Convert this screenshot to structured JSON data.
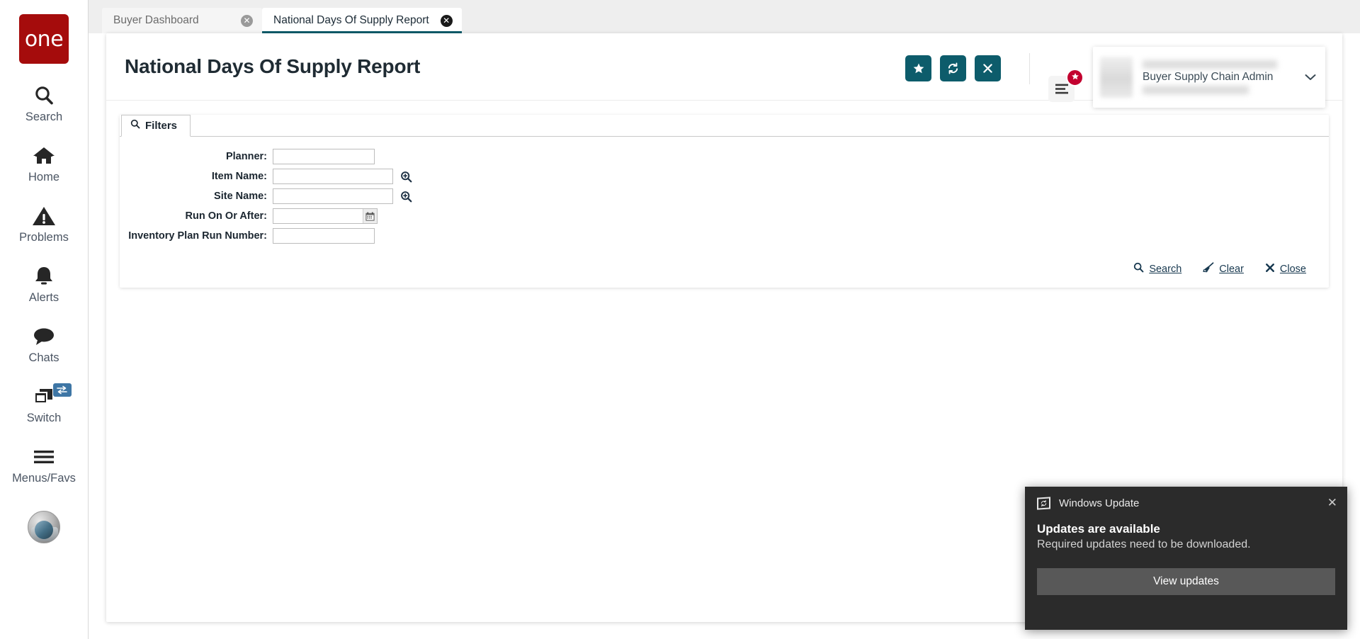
{
  "brand": {
    "logo_text": "one",
    "logo_color": "#a50c0c"
  },
  "theme": {
    "accent": "#0d5c6b",
    "badge": "#c3002f",
    "link": "#17384f"
  },
  "rail": {
    "items": [
      {
        "label": "Search",
        "icon": "search-icon"
      },
      {
        "label": "Home",
        "icon": "home-icon"
      },
      {
        "label": "Problems",
        "icon": "warning-triangle-icon"
      },
      {
        "label": "Alerts",
        "icon": "bell-icon"
      },
      {
        "label": "Chats",
        "icon": "chat-bubble-icon"
      },
      {
        "label": "Switch",
        "icon": "windows-stack-icon",
        "badge_icon": "swap-arrows-icon"
      },
      {
        "label": "Menus/Favs",
        "icon": "hamburger-icon"
      }
    ]
  },
  "tabs": [
    {
      "label": "Buyer Dashboard",
      "active": false,
      "close_icon": "close-circle-icon"
    },
    {
      "label": "National Days Of Supply Report",
      "active": true,
      "close_icon": "close-circle-icon"
    }
  ],
  "header": {
    "title": "National Days Of Supply Report",
    "actions": [
      {
        "name": "favorite-button",
        "icon": "star-icon"
      },
      {
        "name": "refresh-button",
        "icon": "refresh-icon"
      },
      {
        "name": "close-button",
        "icon": "x-icon"
      }
    ],
    "menu_icon": "hamburger-icon",
    "menu_badge_icon": "star-icon",
    "user": {
      "role": "Buyer Supply Chain Admin",
      "caret_icon": "chevron-down-icon"
    }
  },
  "filters": {
    "tab_label": "Filters",
    "tab_icon": "search-icon",
    "fields": [
      {
        "label": "Planner:",
        "value": "",
        "placeholder": "",
        "width": "short",
        "trailing_icon": null
      },
      {
        "label": "Item Name:",
        "value": "",
        "placeholder": "",
        "width": "long",
        "trailing_icon": "magnifier-plus-icon"
      },
      {
        "label": "Site Name:",
        "value": "",
        "placeholder": "",
        "width": "long",
        "trailing_icon": "magnifier-plus-icon"
      },
      {
        "label": "Run On Or After:",
        "value": "",
        "placeholder": "",
        "width": "date",
        "trailing_icon": "calendar-icon"
      },
      {
        "label": "Inventory Plan Run Number:",
        "value": "",
        "placeholder": "",
        "width": "short",
        "trailing_icon": null
      }
    ],
    "actions": [
      {
        "label": "Search",
        "icon": "search-icon"
      },
      {
        "label": "Clear",
        "icon": "broom-icon"
      },
      {
        "label": "Close",
        "icon": "x-icon"
      }
    ]
  },
  "toast": {
    "app_title": "Windows Update",
    "app_icon": "windows-update-icon",
    "close_icon": "close-icon",
    "title": "Updates are available",
    "subtitle": "Required updates need to be downloaded.",
    "button_label": "View updates"
  }
}
